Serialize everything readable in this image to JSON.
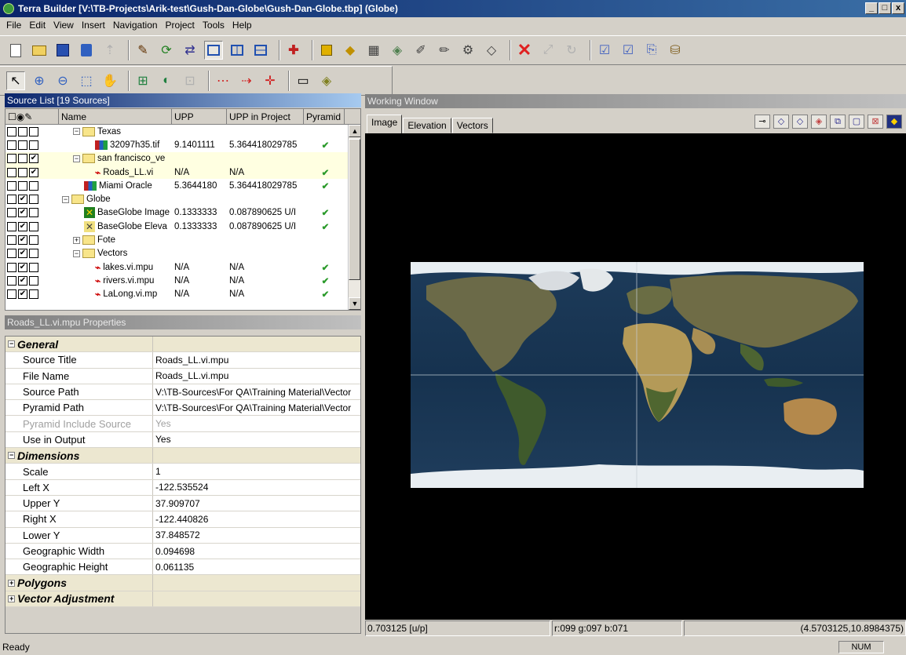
{
  "window": {
    "title": "Terra Builder [V:\\TB-Projects\\Arik-test\\Gush-Dan-Globe\\Gush-Dan-Globe.tbp] (Globe)",
    "buttons": [
      "_",
      "□",
      "x"
    ]
  },
  "menu": [
    "File",
    "Edit",
    "View",
    "Insert",
    "Navigation",
    "Project",
    "Tools",
    "Help"
  ],
  "source_list": {
    "title": "Source List [19 Sources]",
    "columns": [
      "Name",
      "UPP",
      "UPP in Project",
      "Pyramid"
    ],
    "rows": [
      {
        "checks": [
          false,
          false,
          false
        ],
        "indent": 1,
        "kind": "folder-open",
        "name": "Texas",
        "upp": "",
        "upp_project": "",
        "pyramid": ""
      },
      {
        "checks": [
          false,
          false,
          false
        ],
        "indent": 3,
        "kind": "raster",
        "name": "32097h35.tif",
        "upp": "9.1401111",
        "upp_project": "5.364418029785",
        "pyramid": "✔"
      },
      {
        "checks": [
          false,
          false,
          true
        ],
        "indent": 1,
        "kind": "folder-open",
        "name": "san francisco_ve",
        "upp": "",
        "upp_project": "",
        "pyramid": ""
      },
      {
        "checks": [
          false,
          false,
          true
        ],
        "indent": 3,
        "kind": "vector",
        "name": "Roads_LL.vi",
        "upp": "N/A",
        "upp_project": "N/A",
        "pyramid": "✔"
      },
      {
        "checks": [
          false,
          false,
          false
        ],
        "indent": 2,
        "kind": "raster",
        "name": "Miami Oracle",
        "upp": "5.3644180",
        "upp_project": "5.364418029785",
        "pyramid": "✔"
      },
      {
        "checks": [
          false,
          true,
          false
        ],
        "indent": 0,
        "kind": "folder-open",
        "name": "Globe",
        "upp": "",
        "upp_project": "",
        "pyramid": ""
      },
      {
        "checks": [
          false,
          true,
          false
        ],
        "indent": 2,
        "kind": "image",
        "name": "BaseGlobe Image",
        "upp": "0.1333333",
        "upp_project": "0.087890625 U/I",
        "pyramid": "✔"
      },
      {
        "checks": [
          false,
          true,
          false
        ],
        "indent": 2,
        "kind": "elev",
        "name": "BaseGlobe Eleva",
        "upp": "0.1333333",
        "upp_project": "0.087890625 U/I",
        "pyramid": "✔"
      },
      {
        "checks": [
          false,
          true,
          false
        ],
        "indent": 1,
        "kind": "folder-closed",
        "name": "Fote",
        "upp": "",
        "upp_project": "",
        "pyramid": ""
      },
      {
        "checks": [
          false,
          true,
          false
        ],
        "indent": 1,
        "kind": "folder-open",
        "name": "Vectors",
        "upp": "",
        "upp_project": "",
        "pyramid": ""
      },
      {
        "checks": [
          false,
          true,
          false
        ],
        "indent": 3,
        "kind": "vector",
        "name": "lakes.vi.mpu",
        "upp": "N/A",
        "upp_project": "N/A",
        "pyramid": "✔"
      },
      {
        "checks": [
          false,
          true,
          false
        ],
        "indent": 3,
        "kind": "vector",
        "name": "rivers.vi.mpu",
        "upp": "N/A",
        "upp_project": "N/A",
        "pyramid": "✔"
      },
      {
        "checks": [
          false,
          true,
          false
        ],
        "indent": 3,
        "kind": "vector",
        "name": "LaLong.vi.mp",
        "upp": "N/A",
        "upp_project": "N/A",
        "pyramid": "✔"
      }
    ]
  },
  "properties": {
    "title": "Roads_LL.vi.mpu Properties",
    "rows": [
      {
        "type": "cat",
        "key": "General",
        "value": ""
      },
      {
        "type": "item",
        "key": "Source Title",
        "value": "Roads_LL.vi.mpu"
      },
      {
        "type": "item",
        "key": "File Name",
        "value": "Roads_LL.vi.mpu"
      },
      {
        "type": "item",
        "key": "Source Path",
        "value": "V:\\TB-Sources\\For QA\\Training Material\\Vector"
      },
      {
        "type": "item",
        "key": "Pyramid Path",
        "value": "V:\\TB-Sources\\For QA\\Training Material\\Vector"
      },
      {
        "type": "dim",
        "key": "Pyramid Include Source",
        "value": "Yes"
      },
      {
        "type": "item",
        "key": "Use in Output",
        "value": "Yes"
      },
      {
        "type": "cat",
        "key": "Dimensions",
        "value": ""
      },
      {
        "type": "item",
        "key": "Scale",
        "value": "1"
      },
      {
        "type": "item",
        "key": "Left X",
        "value": "-122.535524"
      },
      {
        "type": "item",
        "key": "Upper Y",
        "value": "37.909707"
      },
      {
        "type": "item",
        "key": "Right X",
        "value": "-122.440826"
      },
      {
        "type": "item",
        "key": "Lower Y",
        "value": "37.848572"
      },
      {
        "type": "item",
        "key": "Geographic Width",
        "value": "0.094698"
      },
      {
        "type": "item",
        "key": "Geographic Height",
        "value": "0.061135"
      },
      {
        "type": "cat",
        "key": "Polygons",
        "value": ""
      },
      {
        "type": "cat",
        "key": "Vector Adjustment",
        "value": ""
      }
    ]
  },
  "working": {
    "title": "Working Window",
    "tabs": [
      "Image",
      "Elevation",
      "Vectors"
    ],
    "status": {
      "scale": "0.703125 [u/p]",
      "rgb": "r:099 g:097 b:071",
      "coords": "(4.5703125,10.8984375)"
    }
  },
  "statusbar": {
    "text": "Ready",
    "num": "NUM"
  }
}
